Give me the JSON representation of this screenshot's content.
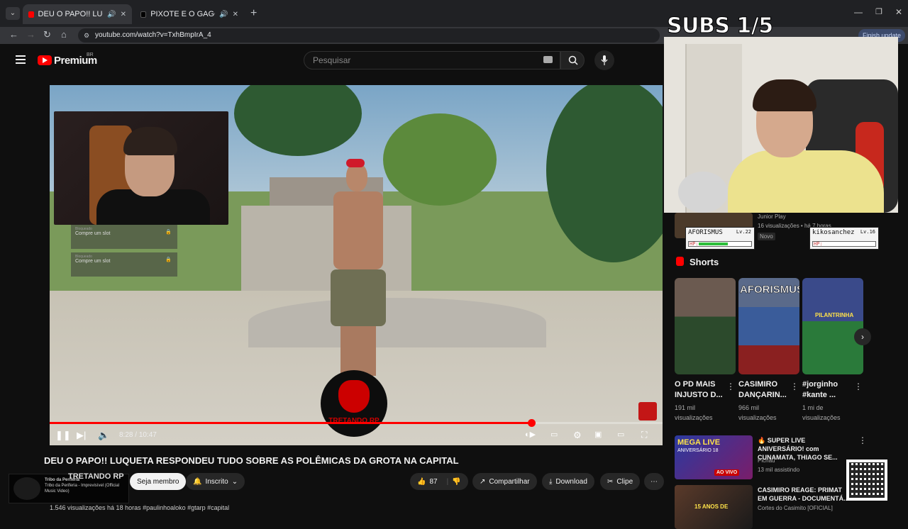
{
  "browser": {
    "tabs": [
      {
        "title": "DEU O PAPO!! LUQUETA RE",
        "active": true
      },
      {
        "title": "PIXOTE E O GAGO LUQUET",
        "active": false
      }
    ],
    "url": "youtube.com/watch?v=TxhBmpIrA_4",
    "update_label": "Finish update"
  },
  "youtube": {
    "logo_text": "Premium",
    "region": "BR",
    "search_placeholder": "Pesquisar"
  },
  "video": {
    "overlay_slots": [
      {
        "label": "Bloqueado",
        "text": "Compre um slot"
      },
      {
        "label": "Bloqueado",
        "text": "Compre um slot"
      }
    ],
    "gang_logo_text": "TRETANDO RP",
    "time_current": "8:28",
    "time_total": "10:47",
    "progress_fraction": 0.786,
    "title": "DEU O PAPO!! LUQUETA RESPONDEU TUDO SOBRE AS POLÊMICAS DA GROTA NA CAPITAL",
    "channel": "TRETANDO RP",
    "join_label": "Seja membro",
    "subscribed_label": "Inscrito",
    "likes": "87",
    "share_label": "Compartilhar",
    "download_label": "Download",
    "clip_label": "Clipe",
    "views_line": "1.546 visualizações  há 18 horas  #paulinhoaloko #gtarp #capital",
    "music_tag": {
      "title": "Tribo da Periferia",
      "subtitle": "Tribo da Periferia - Imprevisível (Official Music Video)"
    }
  },
  "overlay": {
    "subs_label": "SUBS 1/5",
    "players": [
      {
        "name": "AFORISMUS",
        "level": "Lv.22",
        "hp_label": "HP:",
        "hp": 0.55
      },
      {
        "name": "kikosanchez",
        "level": "Lv.16",
        "hp_label": "HP:",
        "hp": 0.0
      }
    ]
  },
  "sidebar": {
    "partial_rec": {
      "channel": "Junior Play",
      "meta": "16 visualizações • há 7 horas",
      "badge": "Novo"
    },
    "shorts_heading": "Shorts",
    "shorts": [
      {
        "title": "O PD MAIS INJUSTO D...",
        "views": "191 mil visualizações"
      },
      {
        "title": "CASIMIRO DANÇARIN...",
        "views": "966 mil visualizações"
      },
      {
        "title": "#jorginho #kante ...",
        "views": "1 mi de visualizações"
      }
    ],
    "shorts_thumb_texts": [
      "AFORISMUS!",
      "PILANTRINHA"
    ],
    "recommendations": [
      {
        "title": "🔥 SUPER LIVE ANIVERSÁRIO! com CUNAMATA, THIAGO SE...",
        "channel": "Pichau",
        "meta": "13 mil assistindo",
        "thumb_text": "MEGA LIVE",
        "thumb_sub": "ANIVERSÁRIO 18",
        "badge": "AO VIVO"
      },
      {
        "title": "CASIMIRO REAGE: PRIMAT EM GUERRA - DOCUMENTÁ...",
        "channel": "Cortes do Casimito [OFICIAL]",
        "thumb_text": "15 ANOS DE"
      }
    ]
  }
}
